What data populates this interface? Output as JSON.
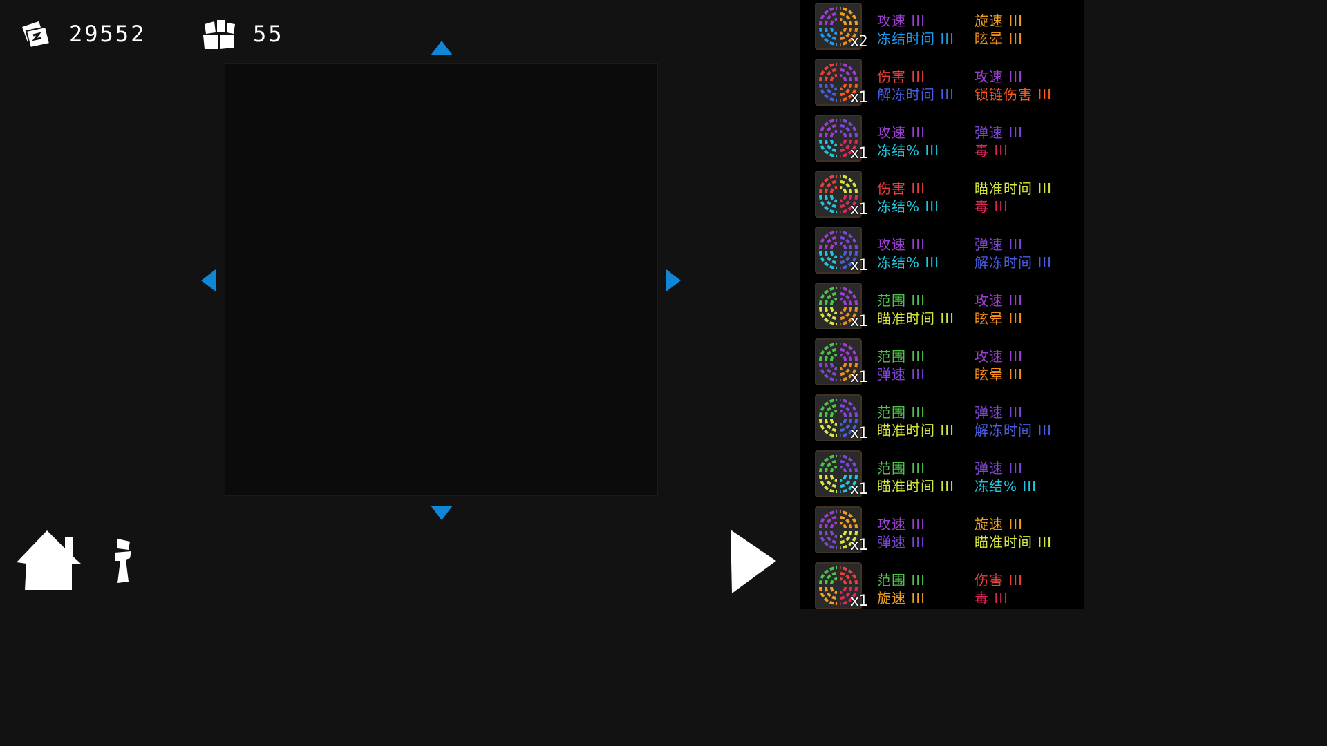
{
  "hud": {
    "gold": "29552",
    "cubes": "55",
    "gold_icon": "gold-bills-icon",
    "cubes_icon": "cubes-icon"
  },
  "controls": {
    "home_icon": "home-icon",
    "info_icon": "info-icon",
    "play_icon": "play-icon",
    "arrow_color": "#0f86d6"
  },
  "stat_colors": {
    "攻速 III": "#9b3fd1",
    "旋速 III": "#f0a020",
    "冻结时间 III": "#1e9bf0",
    "眩晕 III": "#f08c1e",
    "伤害 III": "#e8403c",
    "解冻时间 III": "#4a5de0",
    "锁链伤害 III": "#ff5a1e",
    "弹速 III": "#7d46d8",
    "冻结% III": "#1cc8e0",
    "毒 III": "#e0285a",
    "瞄准时间 III": "#d6e63c",
    "范围 III": "#4cc44c"
  },
  "inventory": [
    {
      "count": "x2",
      "stats": [
        "攻速 III",
        "旋速 III",
        "冻结时间 III",
        "眩晕 III"
      ]
    },
    {
      "count": "x1",
      "stats": [
        "伤害 III",
        "攻速 III",
        "解冻时间 III",
        "锁链伤害 III"
      ]
    },
    {
      "count": "x1",
      "stats": [
        "攻速 III",
        "弹速 III",
        "冻结% III",
        "毒 III"
      ]
    },
    {
      "count": "x1",
      "stats": [
        "伤害 III",
        "瞄准时间 III",
        "冻结% III",
        "毒 III"
      ]
    },
    {
      "count": "x1",
      "stats": [
        "攻速 III",
        "弹速 III",
        "冻结% III",
        "解冻时间 III"
      ]
    },
    {
      "count": "x1",
      "stats": [
        "范围 III",
        "攻速 III",
        "瞄准时间 III",
        "眩晕 III"
      ]
    },
    {
      "count": "x1",
      "stats": [
        "范围 III",
        "攻速 III",
        "弹速 III",
        "眩晕 III"
      ]
    },
    {
      "count": "x1",
      "stats": [
        "范围 III",
        "弹速 III",
        "瞄准时间 III",
        "解冻时间 III"
      ]
    },
    {
      "count": "x1",
      "stats": [
        "范围 III",
        "弹速 III",
        "瞄准时间 III",
        "冻结% III"
      ]
    },
    {
      "count": "x1",
      "stats": [
        "攻速 III",
        "旋速 III",
        "弹速 III",
        "瞄准时间 III"
      ]
    },
    {
      "count": "x1",
      "stats": [
        "范围 III",
        "伤害 III",
        "旋速 III",
        "毒 III"
      ]
    }
  ]
}
